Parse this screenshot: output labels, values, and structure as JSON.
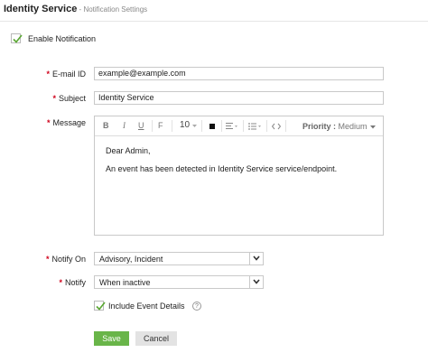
{
  "header": {
    "title": "Identity Service",
    "separator": " - ",
    "subtitle": "Notification Settings"
  },
  "enable_notification": {
    "label": "Enable Notification",
    "checked": true
  },
  "email": {
    "label": "E-mail ID",
    "required": true,
    "value": "example@example.com"
  },
  "subject": {
    "label": "Subject",
    "required": true,
    "value": "Identity Service"
  },
  "message": {
    "label": "Message",
    "required": true,
    "toolbar": {
      "bold": "B",
      "italic": "I",
      "underline": "U",
      "font": "F",
      "font_size": "10",
      "priority_label": "Priority :",
      "priority_value": "Medium"
    },
    "body_lines": [
      "Dear Admin,",
      "An event has been detected in Identity Service service/endpoint."
    ]
  },
  "notify_on": {
    "label": "Notify On",
    "required": true,
    "value": "Advisory, Incident"
  },
  "notify": {
    "label": "Notify",
    "required": true,
    "value": "When inactive"
  },
  "include_event_details": {
    "label": "Include Event Details",
    "checked": true,
    "help": "?"
  },
  "buttons": {
    "save": "Save",
    "cancel": "Cancel"
  },
  "colors": {
    "accent_green": "#69b549",
    "required_red": "#d0021b",
    "check_green": "#5aa832"
  }
}
